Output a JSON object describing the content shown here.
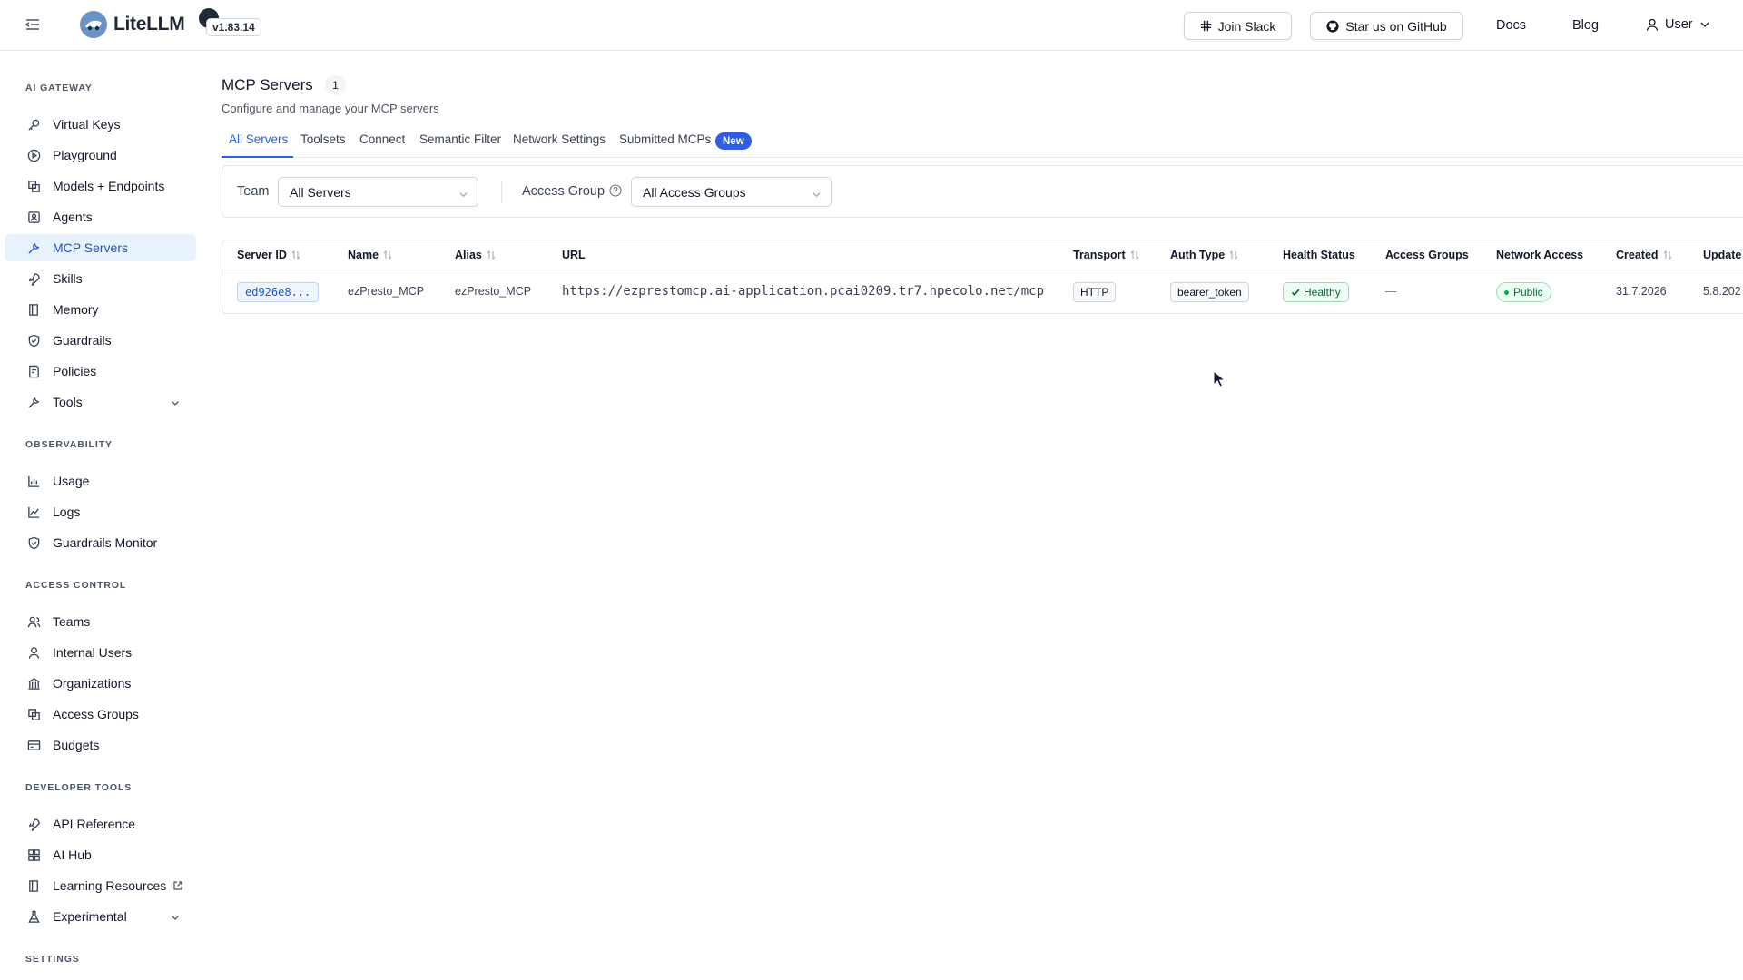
{
  "header": {
    "brand": "LiteLLM",
    "version": "v1.83.14",
    "join_slack": "Join Slack",
    "github": "Star us on GitHub",
    "docs": "Docs",
    "blog": "Blog",
    "user": "User"
  },
  "sidebar": {
    "sections": {
      "ai_gateway": "AI GATEWAY",
      "observability": "OBSERVABILITY",
      "access_control": "ACCESS CONTROL",
      "developer_tools": "DEVELOPER TOOLS",
      "settings": "SETTINGS"
    },
    "items": {
      "virtual_keys": "Virtual Keys",
      "playground": "Playground",
      "models": "Models + Endpoints",
      "agents": "Agents",
      "mcp_servers": "MCP Servers",
      "skills": "Skills",
      "memory": "Memory",
      "guardrails": "Guardrails",
      "policies": "Policies",
      "tools": "Tools",
      "usage": "Usage",
      "logs": "Logs",
      "guardrails_monitor": "Guardrails Monitor",
      "teams": "Teams",
      "internal_users": "Internal Users",
      "organizations": "Organizations",
      "access_groups": "Access Groups",
      "budgets": "Budgets",
      "api_reference": "API Reference",
      "ai_hub": "AI Hub",
      "learning_resources": "Learning Resources",
      "experimental": "Experimental"
    }
  },
  "main": {
    "title": "MCP Servers",
    "count": "1",
    "subtitle": "Configure and manage your MCP servers",
    "tabs": {
      "all": "All Servers",
      "toolsets": "Toolsets",
      "connect": "Connect",
      "semantic": "Semantic Filter",
      "network": "Network Settings",
      "submitted": "Submitted MCPs",
      "new_badge": "New"
    },
    "filters": {
      "team_label": "Team",
      "team_value": "All Servers",
      "access_label": "Access Group",
      "access_value": "All Access Groups"
    },
    "table": {
      "headers": {
        "server_id": "Server ID",
        "name": "Name",
        "alias": "Alias",
        "url": "URL",
        "transport": "Transport",
        "auth_type": "Auth Type",
        "health": "Health Status",
        "access_groups": "Access Groups",
        "network": "Network Access",
        "created": "Created",
        "updated": "Update"
      },
      "row": {
        "server_id": "ed926e8...",
        "name": "ezPresto_MCP",
        "alias": "ezPresto_MCP",
        "url": "https://ezprestomcp.ai-application.pcai0209.tr7.hpecolo.net/mcp",
        "transport": "HTTP",
        "auth_type": "bearer_token",
        "health": "Healthy",
        "access_groups": "—",
        "network": "Public",
        "created": "31.7.2026",
        "updated": "5.8.202"
      }
    }
  }
}
